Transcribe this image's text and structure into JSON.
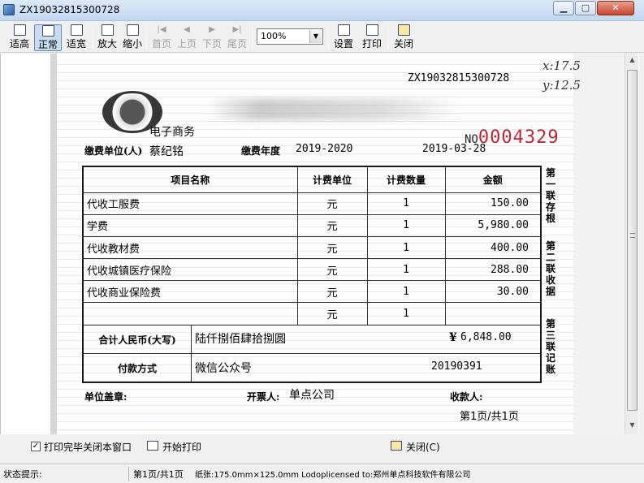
{
  "window": {
    "title": "ZX19032815300728"
  },
  "toolbar": {
    "fit_height": "适高",
    "normal": "正常",
    "fit_width": "适宽",
    "zoom_in": "放大",
    "zoom_out": "缩小",
    "first_page": "首页",
    "prev_page": "上页",
    "next_page": "下页",
    "last_page": "尾页",
    "zoom_value": "100%",
    "settings": "设置",
    "print": "打印",
    "close": "关闭"
  },
  "receipt": {
    "doc_number": "ZX19032815300728",
    "handwritten_x": "x:17.5",
    "handwritten_y": "y:12.5",
    "department": "电子商务",
    "payer_label": "缴费单位(人)",
    "payer_name": "蔡纪铭",
    "year_label": "缴费年度",
    "year_value": "2019-2020",
    "date": "2019-03-28",
    "serial_prefix": "NO",
    "serial_number": "0004329",
    "columns": [
      "项目名称",
      "计费单位",
      "计费数量",
      "金额"
    ],
    "rows": [
      {
        "name": "代收工服费",
        "unit": "元",
        "qty": "1",
        "amount": "150.00"
      },
      {
        "name": "学费",
        "unit": "元",
        "qty": "1",
        "amount": "5,980.00"
      },
      {
        "name": "代收教材费",
        "unit": "元",
        "qty": "1",
        "amount": "400.00"
      },
      {
        "name": "代收城镇医疗保险",
        "unit": "元",
        "qty": "1",
        "amount": "288.00"
      },
      {
        "name": "代收商业保险费",
        "unit": "元",
        "qty": "1",
        "amount": "30.00"
      },
      {
        "name": "",
        "unit": "元",
        "qty": "1",
        "amount": ""
      }
    ],
    "total_label": "合计人民币(大写)",
    "total_words": "陆仟捌佰肆拾捌圆",
    "total_symbol": "¥",
    "total_amount": "6,848.00",
    "pay_method_label": "付款方式",
    "pay_method": "微信公众号",
    "pay_ref": "20190391",
    "seal_label": "单位盖章:",
    "issuer_label": "开票人:",
    "issuer": "单点公司",
    "receiver_label": "收款人:",
    "page_info": "第1页/共1页",
    "side_copy_1": "第一联存根",
    "side_copy_2": "第二联收据",
    "side_copy_3": "第三联记账"
  },
  "options": {
    "close_after_print": "打印完毕关闭本窗口",
    "close_after_print_checked": true,
    "start_print": "开始打印",
    "close": "关闭(C)"
  },
  "status": {
    "label": "状态提示:",
    "page": "第1页/共1页",
    "paper": "纸张:175.0mm×125.0mm Lodoplicensed to:郑州单点科技软件有限公司"
  }
}
